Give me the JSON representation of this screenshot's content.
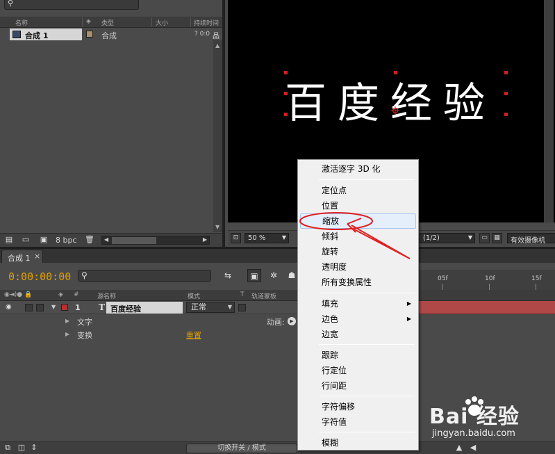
{
  "project": {
    "search_icon": "search-icon",
    "columns": {
      "name": "名称",
      "type": "类型",
      "size": "大小",
      "duration": "持续时间"
    },
    "item": {
      "name": "合成 1",
      "type": "合成",
      "duration": "? 0:0"
    },
    "footer": {
      "bpc": "8 bpc"
    }
  },
  "viewer": {
    "text": "百度经验",
    "zoom": "50 %",
    "resolution": "(1/2)",
    "camera": "有效摄像机"
  },
  "timeline": {
    "tab": "合成 1",
    "timecode": "0:00:00:00",
    "columns": {
      "source_name": "源名称",
      "mode": "模式",
      "t": "T",
      "trkmat": "轨道蒙板",
      "num": "#"
    },
    "ruler": [
      "05f",
      "10f",
      "15f"
    ],
    "layer": {
      "num": "1",
      "type_icon": "T",
      "name": "百度经验",
      "mode": "正常"
    },
    "props": [
      {
        "label": "文字",
        "extra": "动画:"
      },
      {
        "label": "变换",
        "extra": "重置"
      }
    ],
    "footer": {
      "switch_label": "切换开关 / 模式"
    }
  },
  "menu": {
    "items": [
      {
        "label": "激活逐字 3D 化",
        "group": 0
      },
      {
        "label": "定位点",
        "group": 1
      },
      {
        "label": "位置",
        "group": 1
      },
      {
        "label": "缩放",
        "group": 1,
        "highlighted": true
      },
      {
        "label": "倾斜",
        "group": 1
      },
      {
        "label": "旋转",
        "group": 1
      },
      {
        "label": "透明度",
        "group": 1
      },
      {
        "label": "所有变换属性",
        "group": 1
      },
      {
        "label": "填充",
        "group": 2,
        "submenu": true
      },
      {
        "label": "边色",
        "group": 2,
        "submenu": true
      },
      {
        "label": "边宽",
        "group": 2
      },
      {
        "label": "跟踪",
        "group": 3
      },
      {
        "label": "行定位",
        "group": 3
      },
      {
        "label": "行间距",
        "group": 3
      },
      {
        "label": "字符偏移",
        "group": 4
      },
      {
        "label": "字符值",
        "group": 4
      },
      {
        "label": "模糊",
        "group": 5
      }
    ]
  },
  "watermark": {
    "brand": "Bai 经验",
    "url": "jingyan.baidu.com"
  },
  "colors": {
    "timecode": "#e0a000",
    "annotation": "#e02020",
    "menu_bg": "#f0f0f0",
    "highlight": "#e5eefb"
  }
}
